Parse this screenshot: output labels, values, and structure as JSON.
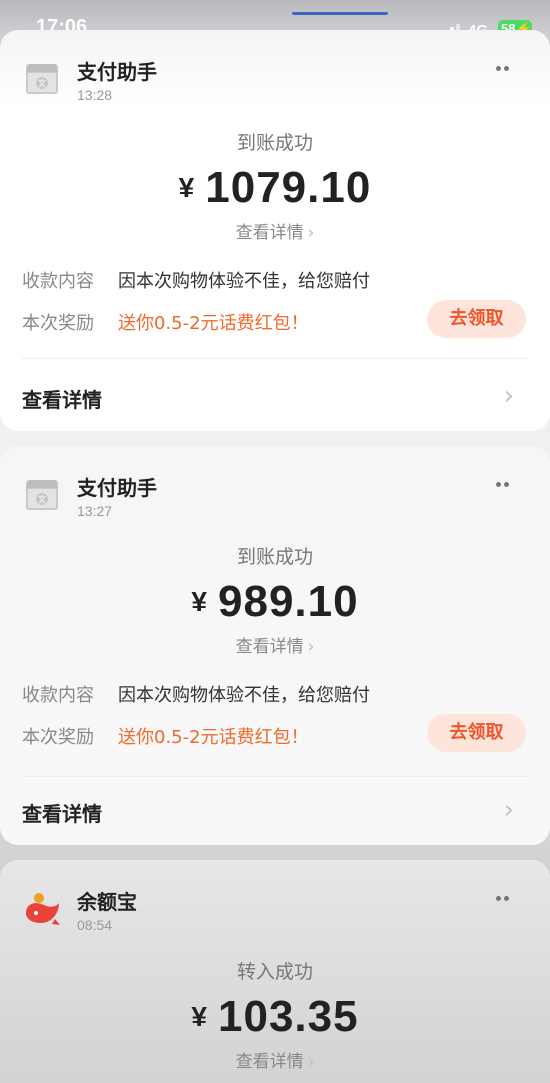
{
  "status_bar": {
    "time": "17:06",
    "network": "4G",
    "battery": "58"
  },
  "cards": [
    {
      "app_icon": "store-icon",
      "app_name": "支付助手",
      "time": "13:28",
      "status": "到账成功",
      "currency": "¥",
      "amount": "1079.10",
      "detail_link": "查看详情",
      "content_label": "收款内容",
      "content_value": "因本次购物体验不佳，给您赔付",
      "reward_label": "本次奖励",
      "reward_value": "送你0.5-2元话费红包！",
      "claim_button": "去领取",
      "footer_link": "查看详情"
    },
    {
      "app_icon": "store-icon",
      "app_name": "支付助手",
      "time": "13:27",
      "status": "到账成功",
      "currency": "¥",
      "amount": "989.10",
      "detail_link": "查看详情",
      "content_label": "收款内容",
      "content_value": "因本次购物体验不佳，给您赔付",
      "reward_label": "本次奖励",
      "reward_value": "送你0.5-2元话费红包！",
      "claim_button": "去领取",
      "footer_link": "查看详情"
    },
    {
      "app_icon": "yuebao-icon",
      "app_name": "余额宝",
      "time": "08:54",
      "status": "转入成功",
      "currency": "¥",
      "amount": "103.35",
      "detail_link": "查看详情"
    }
  ],
  "colors": {
    "accent_orange": "#f06a2c",
    "claim_button_bg": "#fde5dc",
    "battery_green": "#4cd964"
  }
}
